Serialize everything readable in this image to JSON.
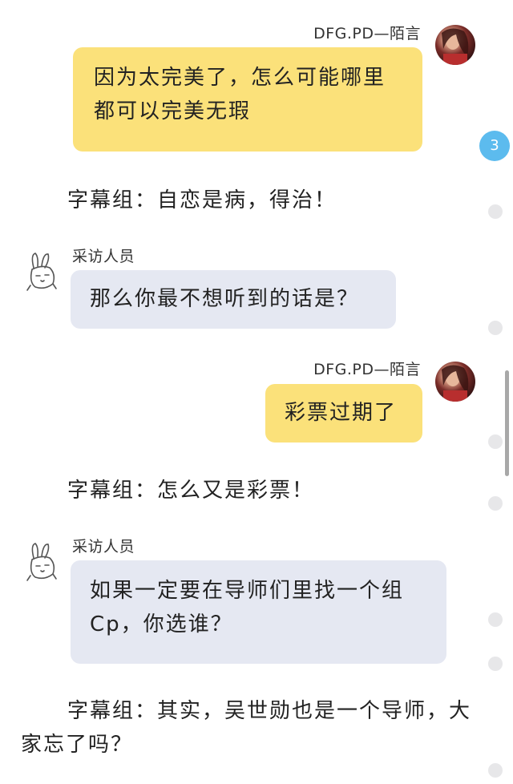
{
  "messages": [
    {
      "sender": "DFG.PD—陌言",
      "text": "因为太完美了，怎么可能哪里都可以完美无瑕"
    },
    {
      "subtitle": "字幕组：自恋是病，得治！"
    },
    {
      "sender": "采访人员",
      "text": "那么你最不想听到的话是？"
    },
    {
      "sender": "DFG.PD—陌言",
      "text": "彩票过期了"
    },
    {
      "subtitle": "字幕组：怎么又是彩票！"
    },
    {
      "sender": "采访人员",
      "text": "如果一定要在导师们里找一个组Cp，你选谁？"
    },
    {
      "subtitle": "字幕组：其实，吴世勋也是一个导师，大家忘了吗？"
    }
  ],
  "side": {
    "badge_count": "3"
  },
  "colors": {
    "yellow_bubble": "#fbe17a",
    "gray_bubble": "#e5e8f2",
    "badge": "#5cbbee"
  },
  "icons": {
    "interviewer_avatar": "bunny-sticker-icon",
    "user_avatar": "photo-avatar"
  }
}
